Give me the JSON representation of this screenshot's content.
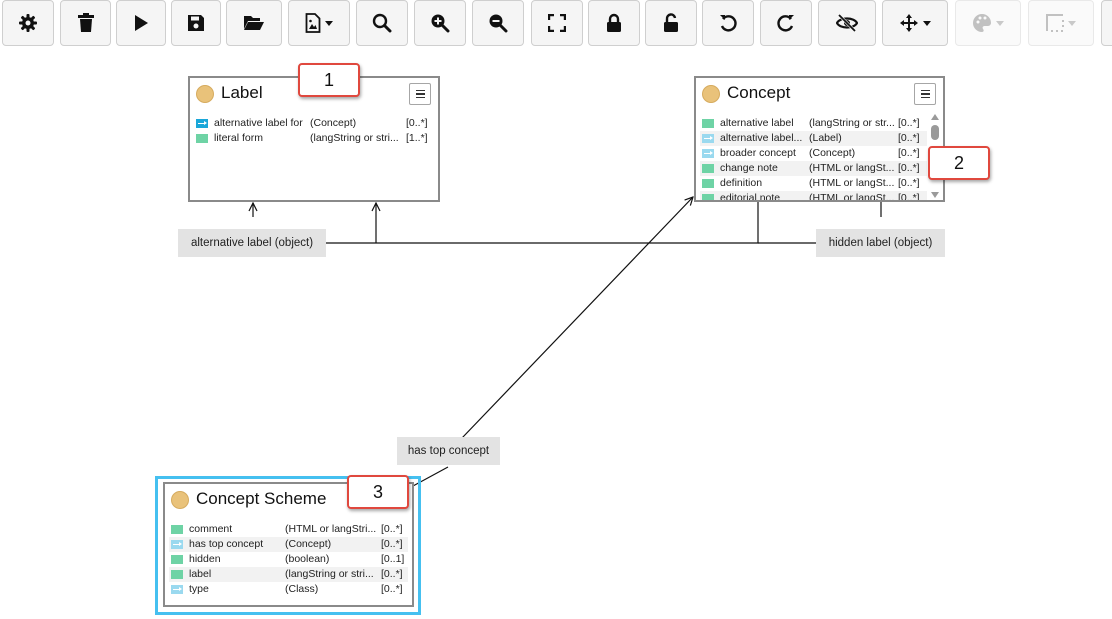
{
  "toolbar": {
    "buttons": [
      {
        "name": "settings-button",
        "icon": "gear-icon"
      },
      {
        "name": "delete-button",
        "icon": "trash-icon"
      },
      {
        "name": "run-button",
        "icon": "play-icon"
      },
      {
        "name": "save-button",
        "icon": "floppy-disk-icon"
      },
      {
        "name": "open-button",
        "icon": "folder-open-icon"
      },
      {
        "name": "export-image-button",
        "icon": "file-image-icon",
        "dropdown": true
      },
      {
        "name": "search-button",
        "icon": "search-icon"
      },
      {
        "name": "zoom-in-button",
        "icon": "zoom-in-icon"
      },
      {
        "name": "zoom-out-button",
        "icon": "zoom-out-icon"
      },
      {
        "name": "fit-screen-button",
        "icon": "expand-icon"
      },
      {
        "name": "lock-button",
        "icon": "lock-icon"
      },
      {
        "name": "unlock-button",
        "icon": "unlock-icon"
      },
      {
        "name": "undo-button",
        "icon": "undo-icon"
      },
      {
        "name": "redo-button",
        "icon": "redo-icon"
      },
      {
        "name": "hide-button",
        "icon": "eye-slash-icon"
      },
      {
        "name": "move-button",
        "icon": "arrows-move-icon",
        "dropdown": true
      },
      {
        "name": "color-button",
        "icon": "palette-icon",
        "dropdown": true,
        "disabled": true
      },
      {
        "name": "border-style-button",
        "icon": "border-style-icon",
        "dropdown": true,
        "disabled": true
      }
    ]
  },
  "classes": {
    "label": {
      "title": "Label",
      "properties": [
        {
          "name": "alternative label for",
          "range": "(Concept)",
          "card": "[0..*]",
          "kind": "object-strong"
        },
        {
          "name": "literal form",
          "range": "(langString or stri...",
          "card": "[1..*]",
          "kind": "literal"
        }
      ]
    },
    "concept": {
      "title": "Concept",
      "properties": [
        {
          "name": "alternative label",
          "range": "(langString or str...",
          "card": "[0..*]",
          "kind": "literal"
        },
        {
          "name": "alternative label...",
          "range": "(Label)",
          "card": "[0..*]",
          "kind": "object"
        },
        {
          "name": "broader concept",
          "range": "(Concept)",
          "card": "[0..*]",
          "kind": "object"
        },
        {
          "name": "change note",
          "range": "(HTML or langSt...",
          "card": "[0..*]",
          "kind": "literal"
        },
        {
          "name": "definition",
          "range": "(HTML or langSt...",
          "card": "[0..*]",
          "kind": "literal"
        },
        {
          "name": "editorial note",
          "range": "(HTML or langSt...",
          "card": "[0..*]",
          "kind": "literal"
        }
      ]
    },
    "concept_scheme": {
      "title": "Concept Scheme",
      "properties": [
        {
          "name": "comment",
          "range": "(HTML or langStri...",
          "card": "[0..*]",
          "kind": "literal"
        },
        {
          "name": "has top concept",
          "range": "(Concept)",
          "card": "[0..*]",
          "kind": "object"
        },
        {
          "name": "hidden",
          "range": "(boolean)",
          "card": "[0..1]",
          "kind": "literal"
        },
        {
          "name": "label",
          "range": "(langString or stri...",
          "card": "[0..*]",
          "kind": "literal"
        },
        {
          "name": "type",
          "range": "(Class)",
          "card": "[0..*]",
          "kind": "object"
        }
      ]
    }
  },
  "edges": {
    "alt_label": "alternative label (object)",
    "hidden_label": "hidden label (object)",
    "has_top_concept": "has top concept"
  },
  "callouts": [
    "1",
    "2",
    "3"
  ],
  "colors": {
    "class_dot": "#e9c27a",
    "literal_icon": "#6ed3a5",
    "object_icon": "#9ad9ef",
    "callout_border": "#e0483e",
    "selection_border": "#45c0f0"
  }
}
